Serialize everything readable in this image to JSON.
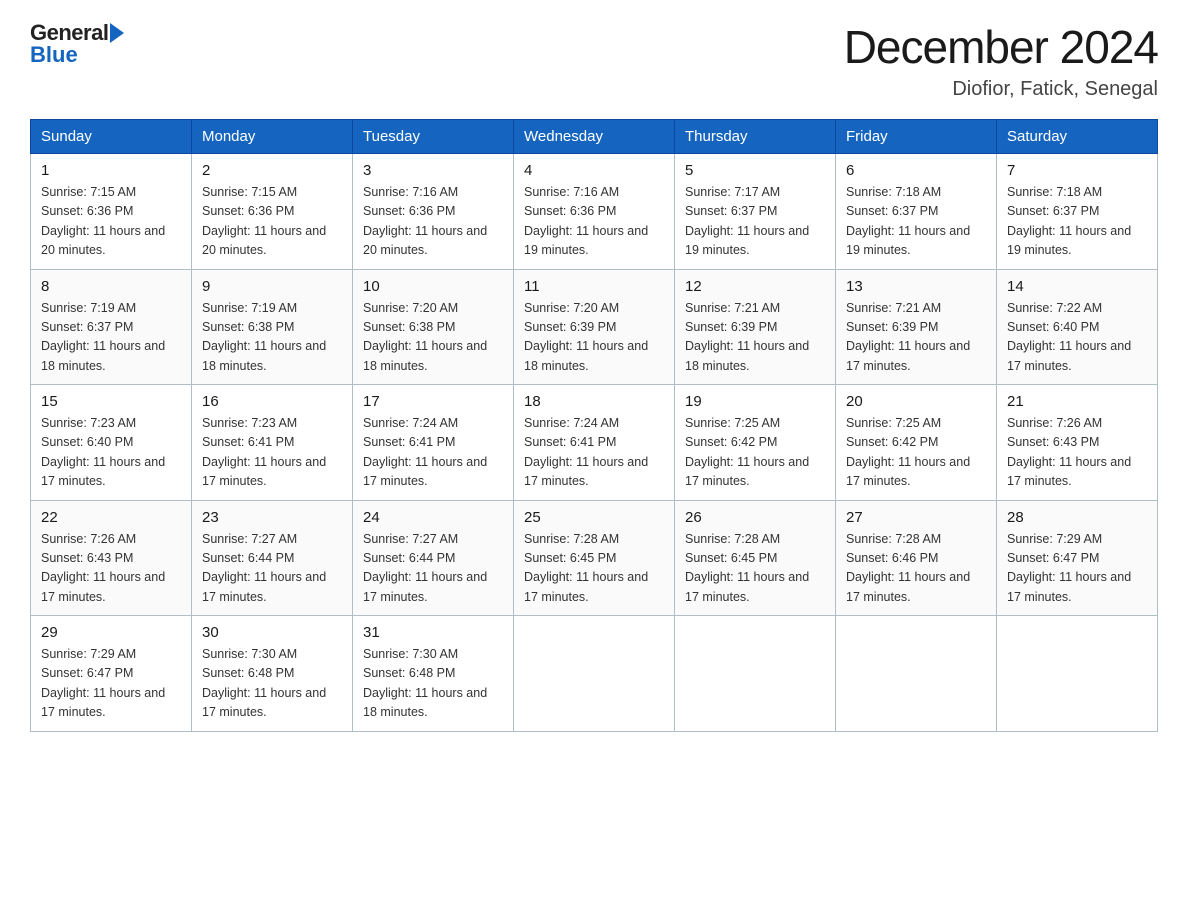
{
  "header": {
    "logo_general": "General",
    "logo_blue": "Blue",
    "month_title": "December 2024",
    "location": "Diofior, Fatick, Senegal"
  },
  "days_of_week": [
    "Sunday",
    "Monday",
    "Tuesday",
    "Wednesday",
    "Thursday",
    "Friday",
    "Saturday"
  ],
  "weeks": [
    [
      {
        "day": "1",
        "sunrise": "7:15 AM",
        "sunset": "6:36 PM",
        "daylight": "11 hours and 20 minutes."
      },
      {
        "day": "2",
        "sunrise": "7:15 AM",
        "sunset": "6:36 PM",
        "daylight": "11 hours and 20 minutes."
      },
      {
        "day": "3",
        "sunrise": "7:16 AM",
        "sunset": "6:36 PM",
        "daylight": "11 hours and 20 minutes."
      },
      {
        "day": "4",
        "sunrise": "7:16 AM",
        "sunset": "6:36 PM",
        "daylight": "11 hours and 19 minutes."
      },
      {
        "day": "5",
        "sunrise": "7:17 AM",
        "sunset": "6:37 PM",
        "daylight": "11 hours and 19 minutes."
      },
      {
        "day": "6",
        "sunrise": "7:18 AM",
        "sunset": "6:37 PM",
        "daylight": "11 hours and 19 minutes."
      },
      {
        "day": "7",
        "sunrise": "7:18 AM",
        "sunset": "6:37 PM",
        "daylight": "11 hours and 19 minutes."
      }
    ],
    [
      {
        "day": "8",
        "sunrise": "7:19 AM",
        "sunset": "6:37 PM",
        "daylight": "11 hours and 18 minutes."
      },
      {
        "day": "9",
        "sunrise": "7:19 AM",
        "sunset": "6:38 PM",
        "daylight": "11 hours and 18 minutes."
      },
      {
        "day": "10",
        "sunrise": "7:20 AM",
        "sunset": "6:38 PM",
        "daylight": "11 hours and 18 minutes."
      },
      {
        "day": "11",
        "sunrise": "7:20 AM",
        "sunset": "6:39 PM",
        "daylight": "11 hours and 18 minutes."
      },
      {
        "day": "12",
        "sunrise": "7:21 AM",
        "sunset": "6:39 PM",
        "daylight": "11 hours and 18 minutes."
      },
      {
        "day": "13",
        "sunrise": "7:21 AM",
        "sunset": "6:39 PM",
        "daylight": "11 hours and 17 minutes."
      },
      {
        "day": "14",
        "sunrise": "7:22 AM",
        "sunset": "6:40 PM",
        "daylight": "11 hours and 17 minutes."
      }
    ],
    [
      {
        "day": "15",
        "sunrise": "7:23 AM",
        "sunset": "6:40 PM",
        "daylight": "11 hours and 17 minutes."
      },
      {
        "day": "16",
        "sunrise": "7:23 AM",
        "sunset": "6:41 PM",
        "daylight": "11 hours and 17 minutes."
      },
      {
        "day": "17",
        "sunrise": "7:24 AM",
        "sunset": "6:41 PM",
        "daylight": "11 hours and 17 minutes."
      },
      {
        "day": "18",
        "sunrise": "7:24 AM",
        "sunset": "6:41 PM",
        "daylight": "11 hours and 17 minutes."
      },
      {
        "day": "19",
        "sunrise": "7:25 AM",
        "sunset": "6:42 PM",
        "daylight": "11 hours and 17 minutes."
      },
      {
        "day": "20",
        "sunrise": "7:25 AM",
        "sunset": "6:42 PM",
        "daylight": "11 hours and 17 minutes."
      },
      {
        "day": "21",
        "sunrise": "7:26 AM",
        "sunset": "6:43 PM",
        "daylight": "11 hours and 17 minutes."
      }
    ],
    [
      {
        "day": "22",
        "sunrise": "7:26 AM",
        "sunset": "6:43 PM",
        "daylight": "11 hours and 17 minutes."
      },
      {
        "day": "23",
        "sunrise": "7:27 AM",
        "sunset": "6:44 PM",
        "daylight": "11 hours and 17 minutes."
      },
      {
        "day": "24",
        "sunrise": "7:27 AM",
        "sunset": "6:44 PM",
        "daylight": "11 hours and 17 minutes."
      },
      {
        "day": "25",
        "sunrise": "7:28 AM",
        "sunset": "6:45 PM",
        "daylight": "11 hours and 17 minutes."
      },
      {
        "day": "26",
        "sunrise": "7:28 AM",
        "sunset": "6:45 PM",
        "daylight": "11 hours and 17 minutes."
      },
      {
        "day": "27",
        "sunrise": "7:28 AM",
        "sunset": "6:46 PM",
        "daylight": "11 hours and 17 minutes."
      },
      {
        "day": "28",
        "sunrise": "7:29 AM",
        "sunset": "6:47 PM",
        "daylight": "11 hours and 17 minutes."
      }
    ],
    [
      {
        "day": "29",
        "sunrise": "7:29 AM",
        "sunset": "6:47 PM",
        "daylight": "11 hours and 17 minutes."
      },
      {
        "day": "30",
        "sunrise": "7:30 AM",
        "sunset": "6:48 PM",
        "daylight": "11 hours and 17 minutes."
      },
      {
        "day": "31",
        "sunrise": "7:30 AM",
        "sunset": "6:48 PM",
        "daylight": "11 hours and 18 minutes."
      },
      null,
      null,
      null,
      null
    ]
  ]
}
